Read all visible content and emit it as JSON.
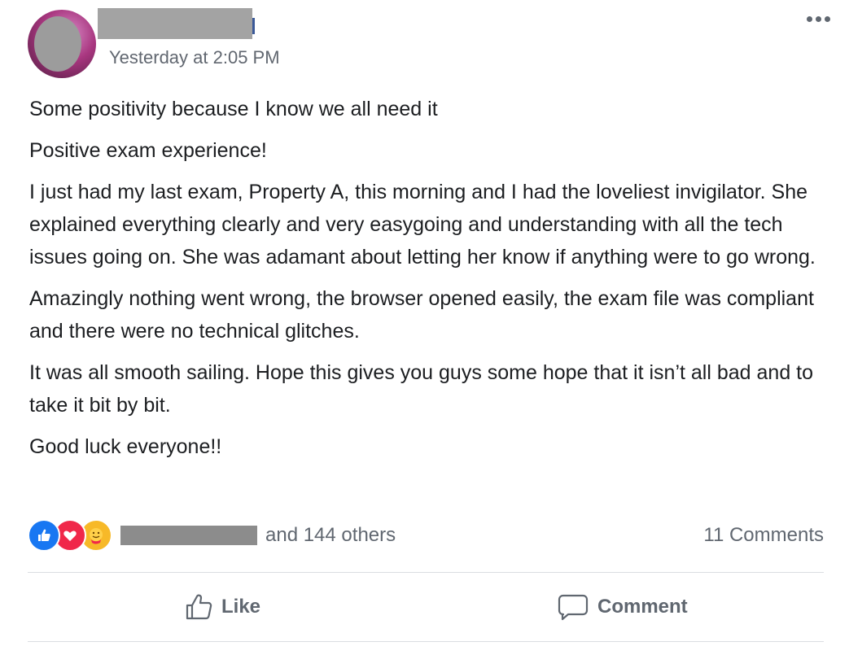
{
  "post": {
    "timestamp": "Yesterday at 2:05 PM",
    "paragraphs": [
      "Some positivity because I know we all need it",
      "Positive exam experience!",
      "I just had my last exam, Property A, this morning and I had the loveliest invigilator. She explained everything clearly and very easygoing and understanding with all the tech issues going on. She was adamant about letting her know if anything were to go wrong.",
      "Amazingly nothing went wrong, the browser opened easily, the exam file was compliant and there were no technical glitches.",
      "It was all smooth sailing. Hope this gives you guys some hope that it isn’t all bad and to take it bit by bit.",
      "Good luck everyone!!"
    ]
  },
  "reactions": {
    "icons": [
      "like-reaction-icon",
      "love-reaction-icon",
      "care-reaction-icon"
    ],
    "others_text": "and 144 others",
    "comments_text": "11 Comments",
    "colors": {
      "like": "#1877f2",
      "love": "#f0284a",
      "care": "#f7b928"
    }
  },
  "actions": {
    "like_label": "Like",
    "comment_label": "Comment"
  }
}
